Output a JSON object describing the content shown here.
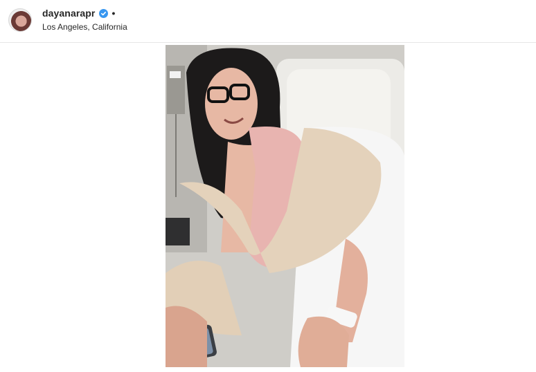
{
  "post": {
    "header": {
      "username": "dayanarapr",
      "dot": "•",
      "location": "Los Angeles, California",
      "verified": true
    },
    "media": {
      "type": "photo"
    }
  },
  "colors": {
    "verified_blue": "#3897f0",
    "text": "#262626",
    "divider": "#e6e6e6"
  }
}
